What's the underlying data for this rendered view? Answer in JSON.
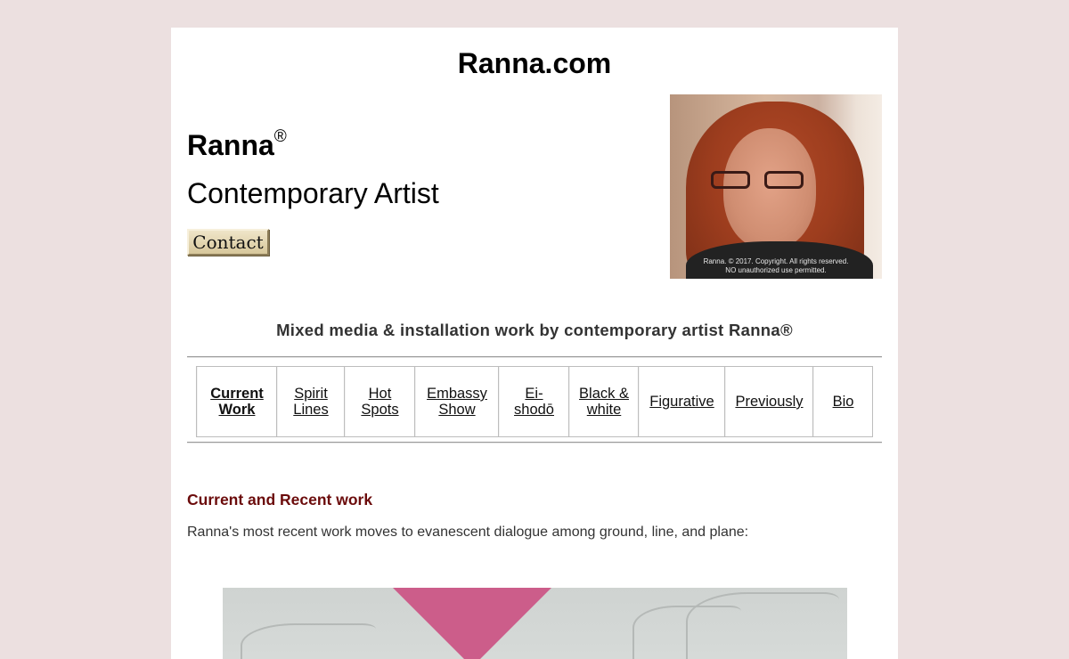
{
  "header": {
    "site_title": "Ranna.com",
    "artist_name": "Ranna",
    "registered_mark": "®",
    "artist_role": "Contemporary Artist",
    "contact_label": "Contact"
  },
  "portrait": {
    "copyright_line1": "Ranna. © 2017. Copyright. All rights reserved.",
    "copyright_line2": "NO unauthorized use permitted."
  },
  "tagline": "Mixed media & installation work by contemporary artist Ranna®",
  "nav": {
    "items": [
      {
        "line1": "Current",
        "line2": "Work",
        "active": true
      },
      {
        "line1": "Spirit",
        "line2": "Lines",
        "active": false
      },
      {
        "line1": "Hot",
        "line2": "Spots",
        "active": false
      },
      {
        "line1": "Embassy",
        "line2": "Show",
        "active": false
      },
      {
        "line1": "Ei-",
        "line2": "shodō",
        "active": false
      },
      {
        "line1": "Black &",
        "line2": "white",
        "active": false
      },
      {
        "line1": "Figurative",
        "line2": "",
        "active": false
      },
      {
        "line1": "Previously",
        "line2": "",
        "active": false
      },
      {
        "line1": "Bio",
        "line2": "",
        "active": false
      }
    ]
  },
  "main": {
    "section_heading": "Current and Recent work",
    "intro_text": "Ranna's most recent work moves to evanescent dialogue among ground, line, and plane:"
  },
  "colors": {
    "background": "#ece0e0",
    "heading_accent": "#6b0b0b",
    "artwork_pink": "#cc5d8a"
  }
}
